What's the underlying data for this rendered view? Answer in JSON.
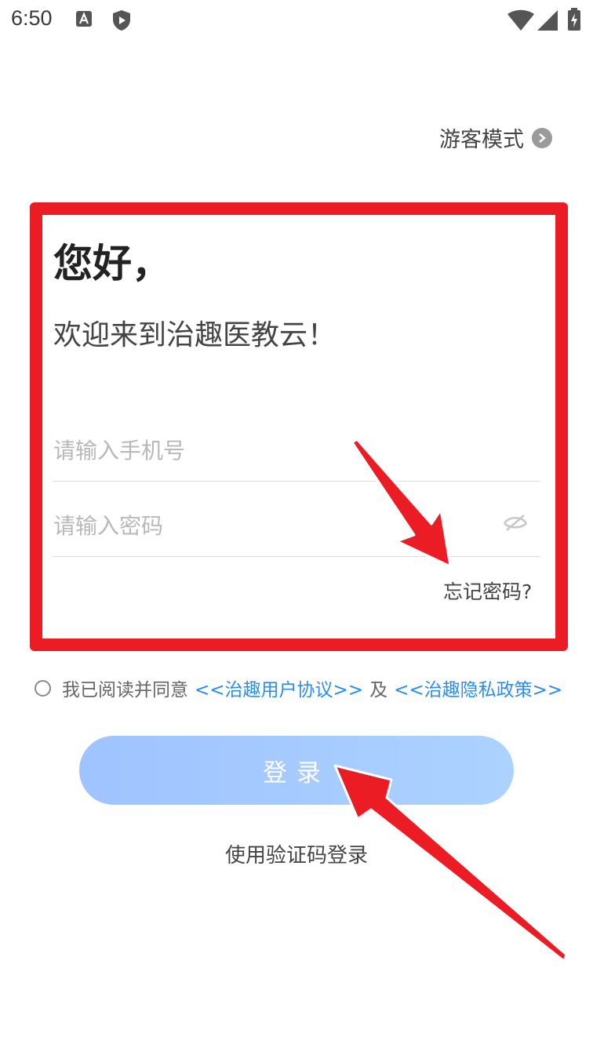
{
  "status_bar": {
    "time": "6:50",
    "icons": [
      "a-app-icon",
      "play-shield-icon",
      "wifi-icon",
      "signal-icon",
      "battery-charging-icon"
    ]
  },
  "guest_mode": {
    "label": "游客模式",
    "icon": "chevron-right-icon"
  },
  "greeting": {
    "hello": "您好，",
    "welcome": "欢迎来到治趣医教云！"
  },
  "form": {
    "phone_placeholder": "请输入手机号",
    "password_placeholder": "请输入密码",
    "password_icon": "eye-off-icon",
    "forgot_password": "忘记密码?"
  },
  "agreement": {
    "checked": false,
    "text": "我已阅读并同意",
    "user_agreement": "<<治趣用户协议>>",
    "and": "及",
    "privacy_policy": "<<治趣隐私政策>>"
  },
  "login_button": "登录",
  "sms_login": "使用验证码登录",
  "colors": {
    "highlight": "#ec1c24",
    "link": "#2c8ee8",
    "button_start": "#9fc3ff",
    "button_end": "#acd2ff"
  }
}
